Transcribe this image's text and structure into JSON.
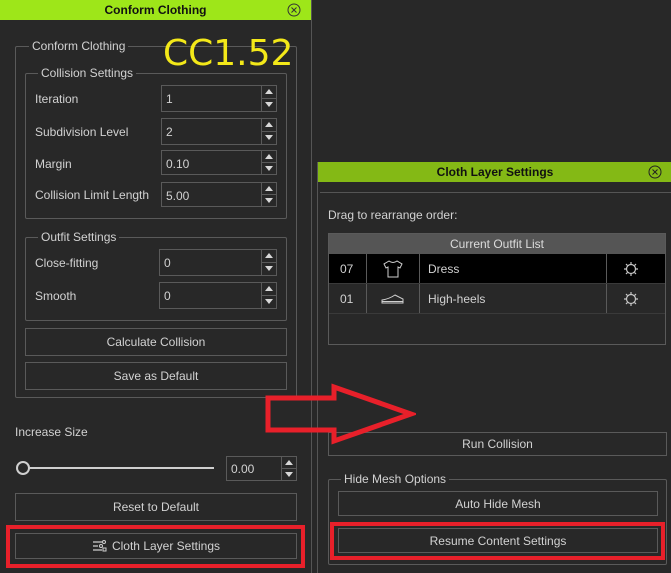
{
  "conform_panel": {
    "title": "Conform Clothing",
    "group_title": "Conform Clothing",
    "version_label": "CC1.52",
    "collision_settings": {
      "title": "Collision Settings",
      "fields": [
        {
          "label": "Iteration",
          "value": "1"
        },
        {
          "label": "Subdivision Level",
          "value": "2"
        },
        {
          "label": "Margin",
          "value": "0.10"
        },
        {
          "label": "Collision Limit Length",
          "value": "5.00"
        }
      ]
    },
    "outfit_settings": {
      "title": "Outfit Settings",
      "fields": [
        {
          "label": "Close-fitting",
          "value": "0"
        },
        {
          "label": "Smooth",
          "value": "0"
        }
      ]
    },
    "calculate_collision_label": "Calculate Collision",
    "save_default_label": "Save as Default",
    "increase_size": {
      "label": "Increase Size",
      "value": "0.00",
      "slider_fraction": 0.0
    },
    "reset_default_label": "Reset to Default",
    "cloth_layer_settings_label": "Cloth Layer Settings"
  },
  "cloth_layer_panel": {
    "title": "Cloth Layer Settings",
    "instruction": "Drag to rearrange order:",
    "list_header": "Current Outfit List",
    "outfits": [
      {
        "order": "07",
        "icon": "shirt-icon",
        "name": "Dress",
        "selected": true
      },
      {
        "order": "01",
        "icon": "shoe-icon",
        "name": "High-heels",
        "selected": false
      }
    ],
    "run_collision_label": "Run Collision",
    "hide_mesh": {
      "title": "Hide Mesh Options",
      "auto_hide_label": "Auto Hide Mesh",
      "resume_label": "Resume Content Settings"
    }
  },
  "colors": {
    "left_title_bar": "#9ee619",
    "right_title_bar": "#84b915",
    "highlight": "#e8202a",
    "version_text": "#f3e819",
    "background": "#282828"
  }
}
